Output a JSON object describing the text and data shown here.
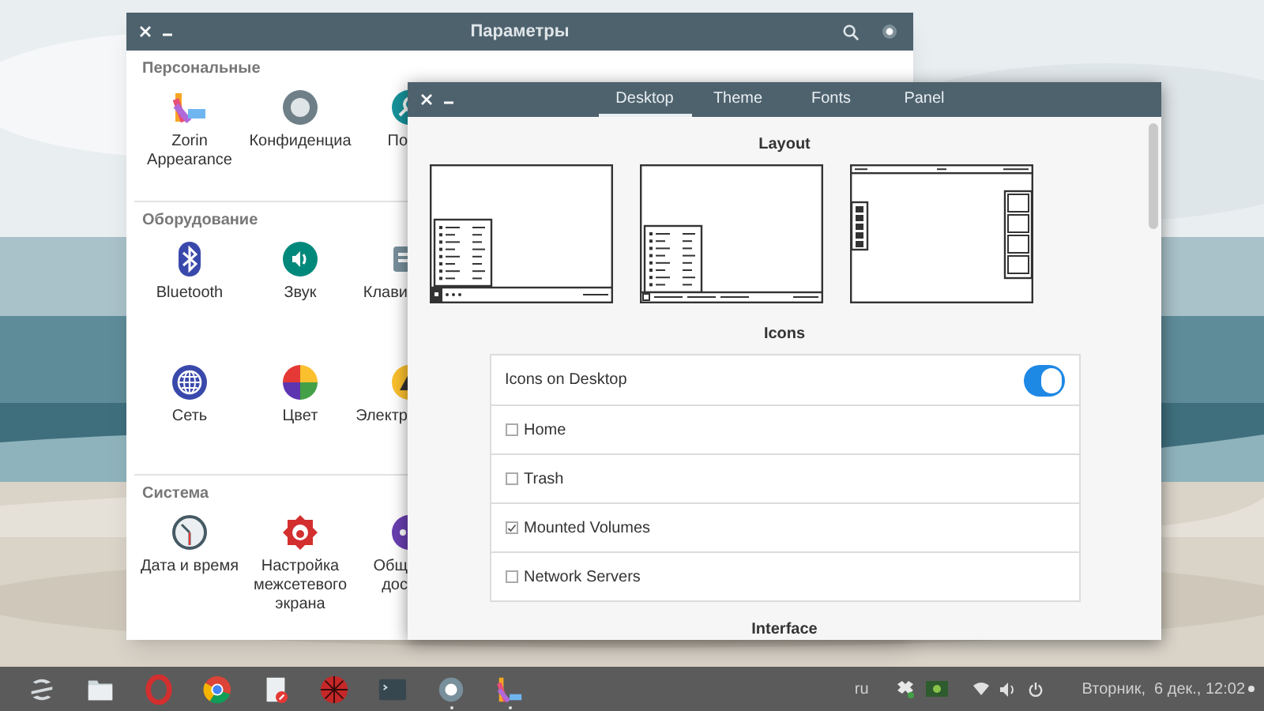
{
  "settings_window": {
    "title": "Параметры",
    "sections": [
      {
        "title": "Персональные",
        "items": [
          {
            "kind": "swatch",
            "lines": [
              "Zorin",
              "Appearance"
            ]
          },
          {
            "kind": "privacy",
            "lines": [
              "Конфиденциа"
            ]
          },
          {
            "kind": "search",
            "lines": [
              "По"
            ]
          }
        ]
      },
      {
        "title": "Оборудование",
        "items": [
          {
            "kind": "bluetooth",
            "lines": [
              "Bluetooth"
            ]
          },
          {
            "kind": "sound",
            "lines": [
              "Звук"
            ]
          },
          {
            "kind": "keyboard",
            "lines": [
              "Клави"
            ]
          },
          {
            "kind": "network",
            "lines": [
              "Сеть"
            ]
          },
          {
            "kind": "color",
            "lines": [
              "Цвет"
            ]
          },
          {
            "kind": "power",
            "lines": [
              "Электр"
            ]
          }
        ]
      },
      {
        "title": "Система",
        "items": [
          {
            "kind": "clock",
            "lines": [
              "Дата и время"
            ]
          },
          {
            "kind": "firewall",
            "lines": [
              "Настройка",
              "межсетевого",
              "экрана"
            ]
          },
          {
            "kind": "sharing",
            "lines": [
              "Общ",
              "дос"
            ]
          }
        ]
      }
    ]
  },
  "tweak_window": {
    "tabs": [
      {
        "label": "Desktop",
        "selected": true
      },
      {
        "label": "Theme",
        "selected": false
      },
      {
        "label": "Fonts",
        "selected": false
      },
      {
        "label": "Panel",
        "selected": false
      }
    ],
    "layout_title": "Layout",
    "layouts": [
      {
        "kind": "menu-left"
      },
      {
        "kind": "menu-panel"
      },
      {
        "kind": "dock-top"
      }
    ],
    "icons_title": "Icons",
    "icon_options": [
      {
        "kind": "toggle",
        "label": "Icons on Desktop",
        "on": true
      },
      {
        "kind": "checkbox",
        "label": "Home",
        "checked": false
      },
      {
        "kind": "checkbox",
        "label": "Trash",
        "checked": false
      },
      {
        "kind": "checkbox",
        "label": "Mounted Volumes",
        "checked": true
      },
      {
        "kind": "checkbox",
        "label": "Network Servers",
        "checked": false
      }
    ],
    "interface_title": "Interface"
  },
  "taskbar": {
    "apps": [
      {
        "kind": "zorin",
        "running": false
      },
      {
        "kind": "files",
        "running": false
      },
      {
        "kind": "opera",
        "running": false
      },
      {
        "kind": "chrome",
        "running": false
      },
      {
        "kind": "note",
        "running": false
      },
      {
        "kind": "ball",
        "running": false
      },
      {
        "kind": "terminal",
        "running": false
      },
      {
        "kind": "settings",
        "running": true
      },
      {
        "kind": "appearance",
        "running": true
      }
    ],
    "keyboard_layout": "ru",
    "clock": "Вторник,  6 дек., 12:02"
  }
}
